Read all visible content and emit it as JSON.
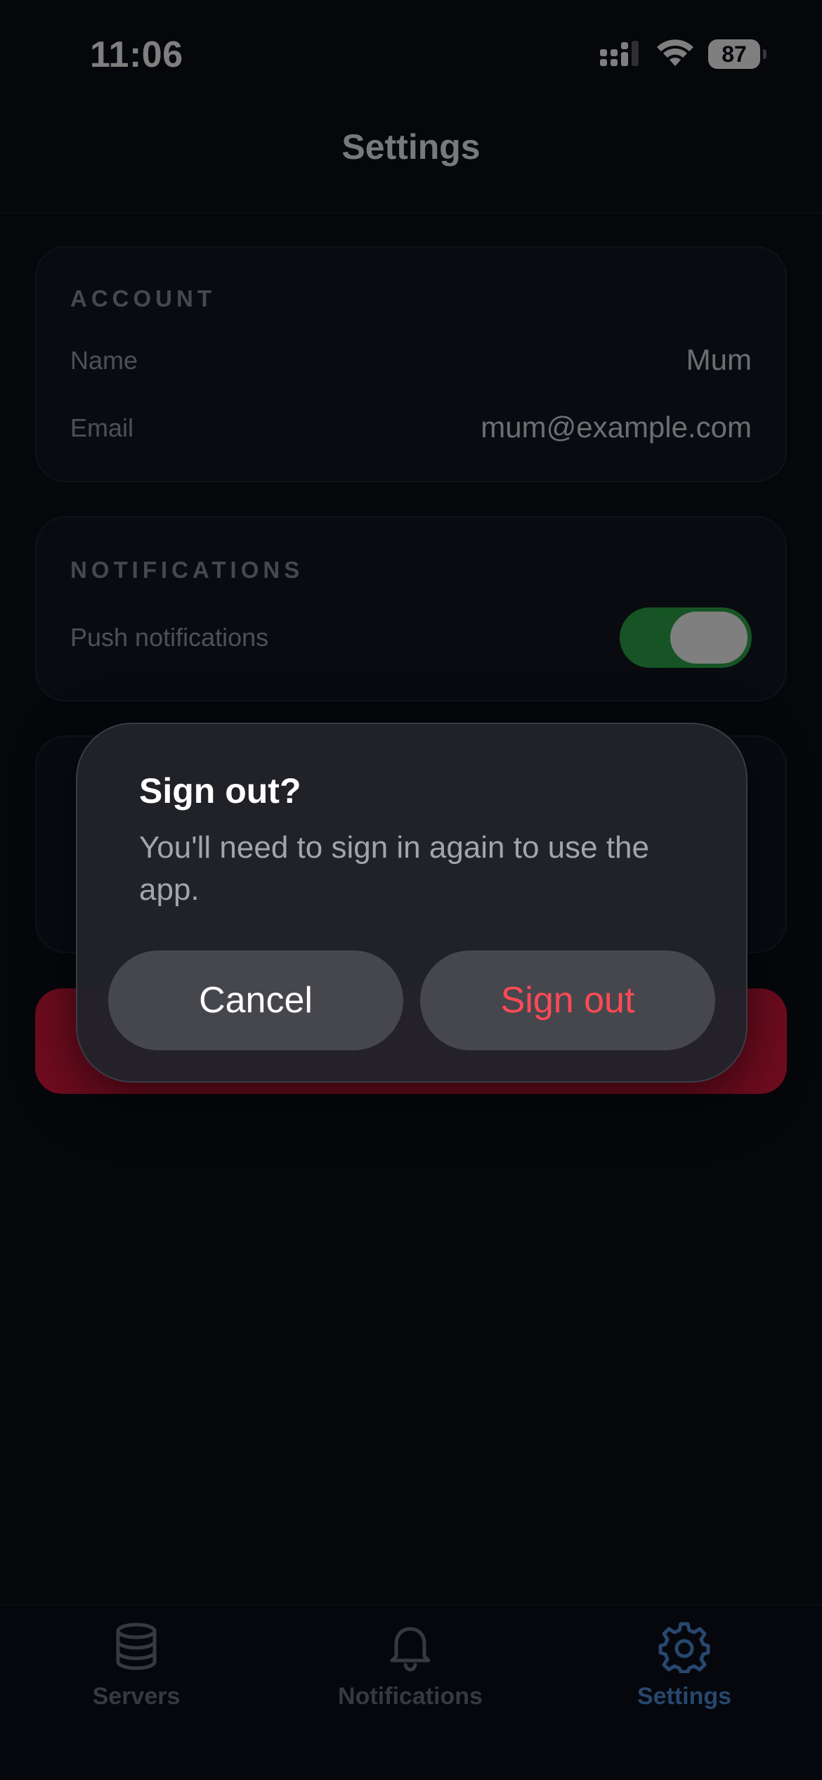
{
  "status_bar": {
    "time": "11:06",
    "battery": "87",
    "icons": [
      "signal-icon",
      "wifi-icon",
      "battery-icon"
    ]
  },
  "header": {
    "title": "Settings"
  },
  "account": {
    "section_title": "ACCOUNT",
    "name_label": "Name",
    "name_value": "Mum",
    "email_label": "Email",
    "email_value": "mum@example.com"
  },
  "notifications": {
    "section_title": "NOTIFICATIONS",
    "push_label": "Push notifications",
    "push_enabled": true
  },
  "dialog": {
    "title": "Sign out?",
    "message": "You'll need to sign in again to use the app.",
    "cancel_label": "Cancel",
    "confirm_label": "Sign out"
  },
  "tab_bar": {
    "tabs": [
      {
        "label": "Servers",
        "icon": "database-icon",
        "active": false
      },
      {
        "label": "Notifications",
        "icon": "bell-icon",
        "active": false
      },
      {
        "label": "Settings",
        "icon": "gear-icon",
        "active": true
      }
    ]
  },
  "colors": {
    "accent": "#4f8fdc",
    "destructive": "#e0193e",
    "toggle_on": "#2ea84a"
  }
}
